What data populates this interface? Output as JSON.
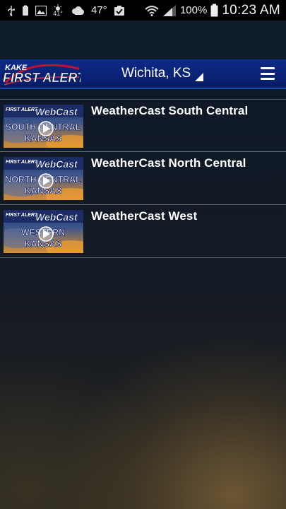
{
  "status_bar": {
    "temp_small": "41°",
    "temp": "47°",
    "battery_percent": "100%",
    "time": "10:23 AM"
  },
  "app_bar": {
    "logo_top": "KAKE",
    "logo_main": "FIRST ALERT",
    "location": "Wichita, KS"
  },
  "webcasts": [
    {
      "title": "WeatherCast South Central",
      "thumb": {
        "badge": "FIRST ALERT",
        "heading": "WebCast",
        "line1": "SOUTH CENTRAL",
        "line2": "KANSAS"
      }
    },
    {
      "title": "WeatherCast North Central",
      "thumb": {
        "badge": "FIRST ALERT",
        "heading": "WebCast",
        "line1": "NORTH CENTRAL",
        "line2": "KANSAS"
      }
    },
    {
      "title": "WeatherCast West",
      "thumb": {
        "badge": "FIRST ALERT",
        "heading": "WebCast",
        "line1": "WESTERN",
        "line2": "KANSAS"
      }
    }
  ]
}
